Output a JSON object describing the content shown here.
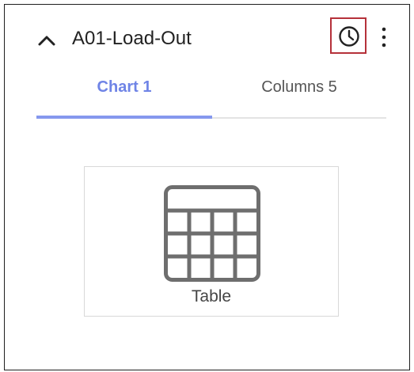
{
  "panel": {
    "title": "A01-Load-Out",
    "collapse_icon": "chevron-up-icon",
    "history_icon": "clock-icon",
    "more_icon": "more-vertical-icon",
    "highlight_color": "#b5313a"
  },
  "tabs": [
    {
      "label": "Chart 1",
      "active": true
    },
    {
      "label": "Columns 5",
      "active": false
    }
  ],
  "accent_color": "#6f84e6",
  "chart_type": {
    "label": "Table",
    "icon": "table-icon"
  }
}
